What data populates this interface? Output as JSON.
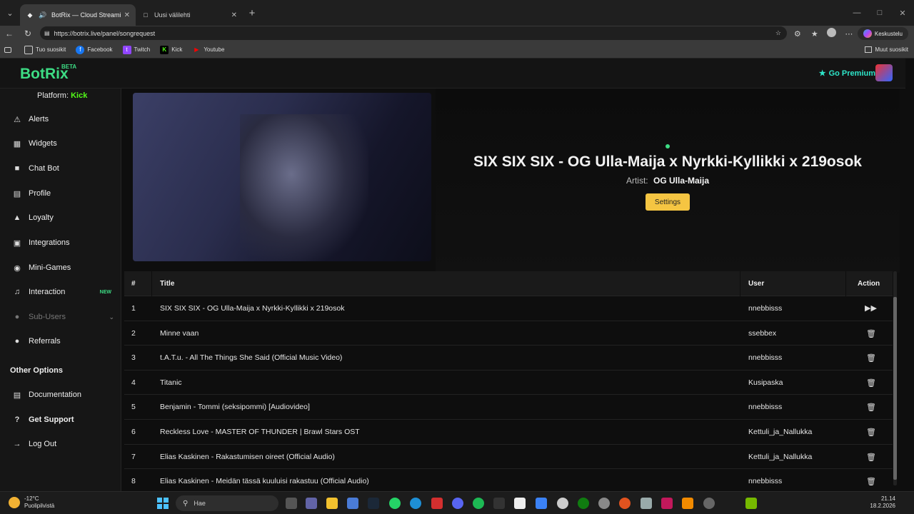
{
  "browser": {
    "tabs": [
      {
        "title": "BotRix — Cloud Streaming Bo",
        "active": true
      },
      {
        "title": "Uusi välilehti",
        "active": false
      }
    ],
    "url": "https://botrix.live/panel/songrequest",
    "profile_button": "Keskustelu",
    "bookmarks": [
      {
        "label": "Tuo suosikit",
        "icon": "import-icon"
      },
      {
        "label": "Facebook",
        "icon": "facebook-icon"
      },
      {
        "label": "Twitch",
        "icon": "twitch-icon"
      },
      {
        "label": "Kick",
        "icon": "kick-icon"
      },
      {
        "label": "Youtube",
        "icon": "youtube-icon"
      }
    ],
    "other_bookmarks": "Muut suosikit"
  },
  "app": {
    "logo": "BotRix",
    "logo_badge": "BETA",
    "go_premium": "Go Premium",
    "platform_label": "Platform:",
    "platform_value": "Kick",
    "nav": [
      {
        "label": "Alerts",
        "icon": "warning-icon"
      },
      {
        "label": "Widgets",
        "icon": "grid-icon"
      },
      {
        "label": "Chat Bot",
        "icon": "robot-icon"
      },
      {
        "label": "Profile",
        "icon": "id-card-icon"
      },
      {
        "label": "Loyalty",
        "icon": "trophy-icon"
      },
      {
        "label": "Integrations",
        "icon": "plug-icon"
      },
      {
        "label": "Mini-Games",
        "icon": "gamepad-icon"
      },
      {
        "label": "Interaction",
        "icon": "music-icon",
        "badge": "NEW"
      },
      {
        "label": "Sub-Users",
        "icon": "users-icon"
      },
      {
        "label": "Referrals",
        "icon": "users-icon"
      }
    ],
    "other_options_label": "Other Options",
    "other_nav": [
      {
        "label": "Documentation",
        "icon": "book-icon"
      },
      {
        "label": "Get Support",
        "icon": "question-icon"
      },
      {
        "label": "Log Out",
        "icon": "logout-icon"
      }
    ]
  },
  "now_playing": {
    "title": "SIX SIX SIX - OG Ulla-Maija x Nyrkki-Kyllikki x 219osok",
    "artist_label": "Artist:",
    "artist": "OG Ulla-Maija",
    "settings_label": "Settings"
  },
  "queue": {
    "columns": {
      "num": "#",
      "title": "Title",
      "user": "User",
      "action": "Action"
    },
    "rows": [
      {
        "num": "1",
        "title": "SIX SIX SIX - OG Ulla-Maija x Nyrkki-Kyllikki x 219osok",
        "user": "nnebbisss",
        "action": "skip"
      },
      {
        "num": "2",
        "title": "Minne vaan",
        "user": "ssebbex",
        "action": "delete"
      },
      {
        "num": "3",
        "title": "t.A.T.u. - All The Things She Said (Official Music Video)",
        "user": "nnebbisss",
        "action": "delete"
      },
      {
        "num": "4",
        "title": "Titanic",
        "user": "Kusipaska",
        "action": "delete"
      },
      {
        "num": "5",
        "title": "Benjamin - Tommi (seksipommi) [Audiovideo]",
        "user": "nnebbisss",
        "action": "delete"
      },
      {
        "num": "6",
        "title": "Reckless Love - MASTER OF THUNDER | Brawl Stars OST",
        "user": "Kettuli_ja_Nallukka",
        "action": "delete"
      },
      {
        "num": "7",
        "title": "Elias Kaskinen - Rakastumisen oireet (Official Audio)",
        "user": "Kettuli_ja_Nallukka",
        "action": "delete"
      },
      {
        "num": "8",
        "title": "Elias Kaskinen - Meidän tässä kuuluisi rakastuu (Official Audio)",
        "user": "nnebbisss",
        "action": "delete"
      }
    ]
  },
  "taskbar": {
    "weather_temp": "-12°C",
    "weather_desc": "Puolipilvistä",
    "search_placeholder": "Hae",
    "time": "21.14",
    "date": "18.2.2026"
  },
  "colors": {
    "brand": "#3ddc84",
    "premium": "#2ee5c9",
    "settings_button": "#f5c542",
    "kick": "#53fc18"
  }
}
